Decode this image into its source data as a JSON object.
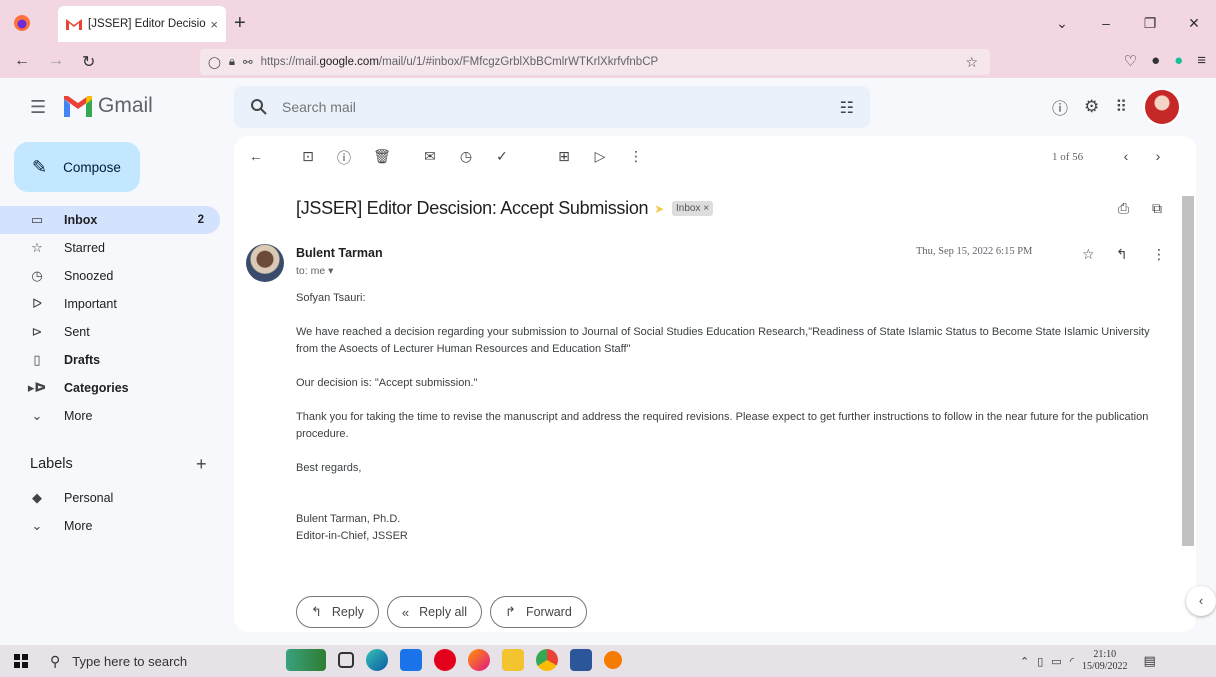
{
  "browser": {
    "tab_title": "[JSSER] Editor Decision -",
    "tab_close": "×",
    "new_tab": "+",
    "url_prefix": "https://mail.",
    "url_domain": "google.com",
    "url_path": "/mail/u/1/#inbox/FMfcgzGrblXbBCmlrWTKrlXkrfvfnbCP",
    "window_controls": [
      "⌄",
      "–",
      "❐",
      "✕"
    ]
  },
  "gmail": {
    "logo_text": "Gmail",
    "search_placeholder": "Search mail"
  },
  "sidebar": {
    "compose_label": "Compose",
    "items": [
      {
        "label": "Inbox",
        "count": "2",
        "icon": "inbox-icon",
        "glyph": "▭"
      },
      {
        "label": "Starred",
        "count": "",
        "icon": "star-icon",
        "glyph": "☆"
      },
      {
        "label": "Snoozed",
        "count": "",
        "icon": "clock-icon",
        "glyph": "◷"
      },
      {
        "label": "Important",
        "count": "",
        "icon": "important-icon",
        "glyph": "ᐅ"
      },
      {
        "label": "Sent",
        "count": "",
        "icon": "send-icon",
        "glyph": "⊳"
      },
      {
        "label": "Drafts",
        "count": "",
        "icon": "draft-icon",
        "glyph": "▯"
      },
      {
        "label": "Categories",
        "count": "",
        "icon": "label-icon",
        "glyph": "▸ᐅ"
      },
      {
        "label": "More",
        "count": "",
        "icon": "chevron-down-icon",
        "glyph": "⌄"
      }
    ],
    "labels_title": "Labels",
    "labels_add": "+",
    "label_items": [
      {
        "label": "Personal",
        "icon": "label-filled-icon",
        "glyph": "◆"
      },
      {
        "label": "More",
        "icon": "chevron-down-icon",
        "glyph": "⌄"
      }
    ]
  },
  "message": {
    "pager": "1 of 56",
    "subject": "[JSSER] Editor Descision: Accept Submission",
    "inbox_chip": "Inbox ×",
    "sender_name": "Bulent Tarman",
    "to_me": "to: me ▾",
    "date": "Thu, Sep 15, 2022 6:15 PM",
    "body": [
      "Sofyan Tsauri:",
      "We have reached a decision regarding your submission to Journal of Social Studies Education Research,\"Readiness of State Islamic Status to Become State Islamic University from the Asoects of Lecturer Human Resources and Education Staff\"",
      "Our decision is: \"Accept submission.\"",
      "Thank you for taking the time to revise the manuscript and address the required revisions. Please expect to get further instructions to follow in the near future for the publication procedure.",
      "Best regards,"
    ],
    "signature_name": "Bulent Tarman, Ph.D.",
    "signature_title": "Editor-in-Chief, JSSER",
    "reply_label": "Reply",
    "reply_all_label": "Reply all",
    "forward_label": "Forward"
  },
  "taskbar": {
    "search_placeholder": "Type here to search",
    "time": "21:10",
    "date": "15/09/2022"
  }
}
